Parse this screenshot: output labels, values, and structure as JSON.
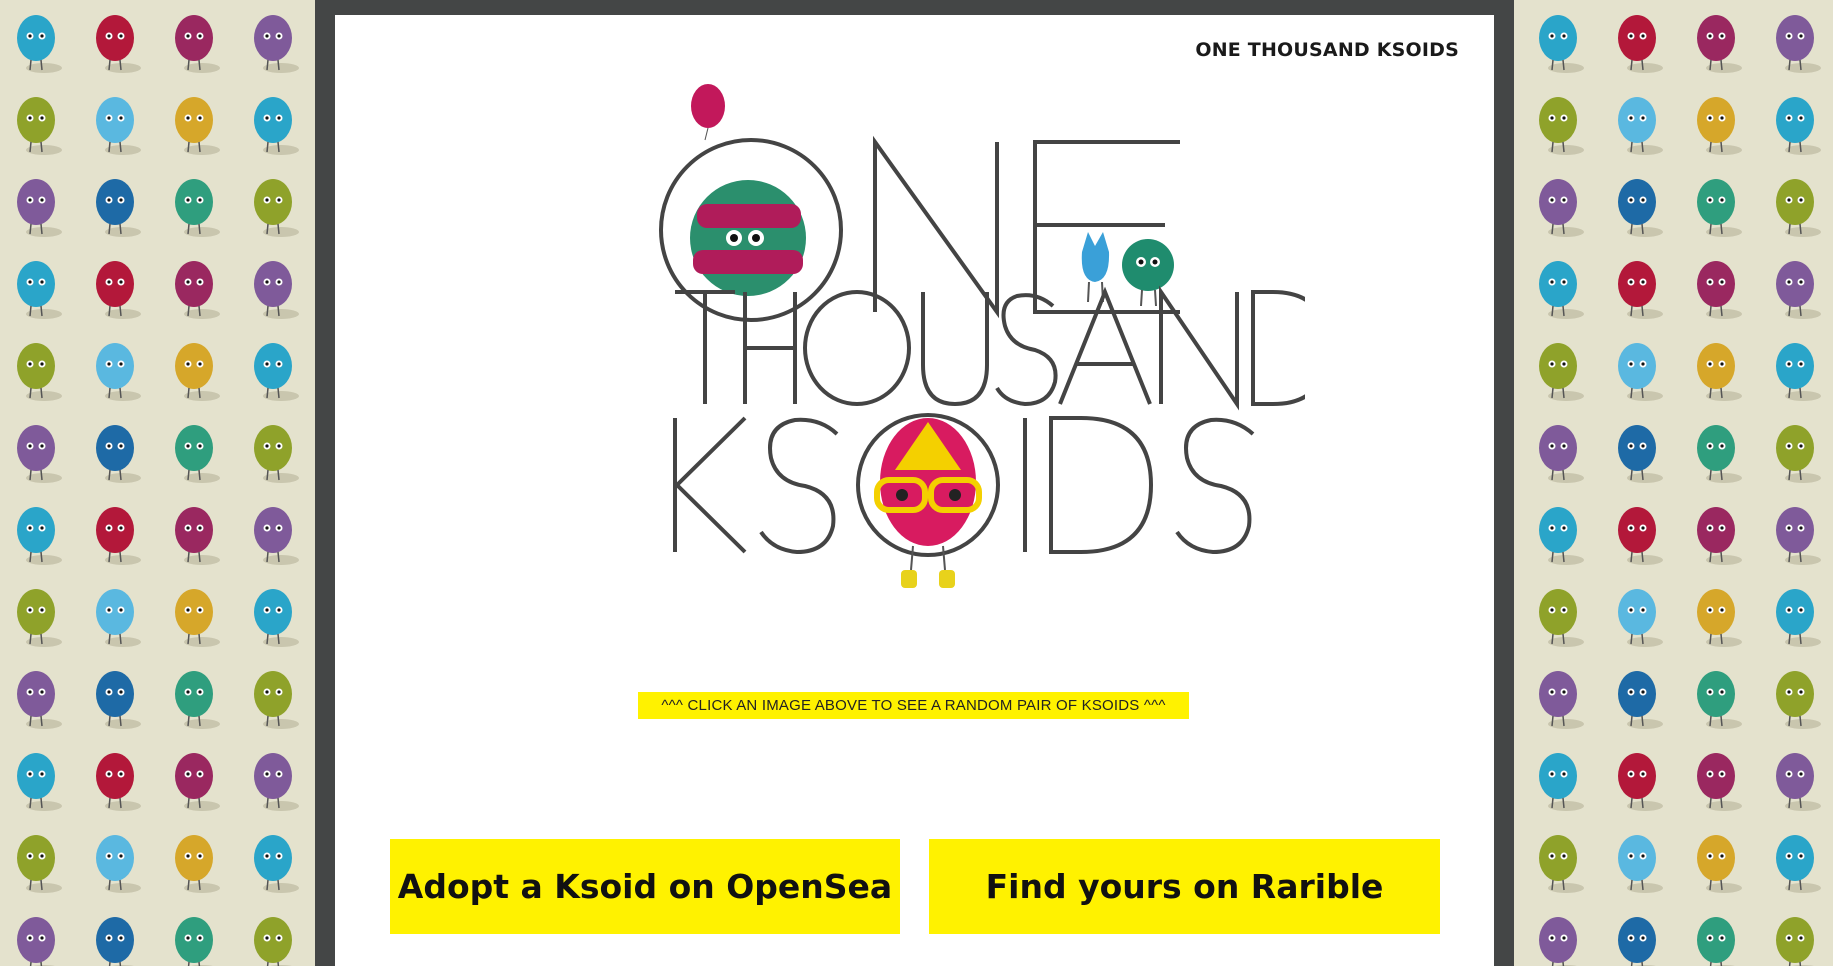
{
  "header": {
    "site_title": "ONE THOUSAND KSOIDS"
  },
  "hero": {
    "logo_words": [
      "ONE",
      "THOUSAND",
      "KSOIDS"
    ]
  },
  "hint": {
    "text": "^^^ CLICK AN IMAGE ABOVE TO SEE A RANDOM PAIR OF KSOIDS ^^^"
  },
  "actions": {
    "opensea_label": "Adopt a Ksoid on OpenSea",
    "rarible_label": "Find yours on Rarible"
  },
  "colors": {
    "accent_yellow": "#fff200",
    "frame_gray": "#444646",
    "wallpaper_bg": "#e4e2cd",
    "logo_stroke": "#444444"
  },
  "wallpaper": {
    "ksoid_palette": [
      "#2aa5c9",
      "#9a2860",
      "#1e6aa6",
      "#8fa22a",
      "#d6a72a",
      "#b3183a",
      "#7f5a9a",
      "#2f9e7e",
      "#5ab8e0"
    ]
  }
}
